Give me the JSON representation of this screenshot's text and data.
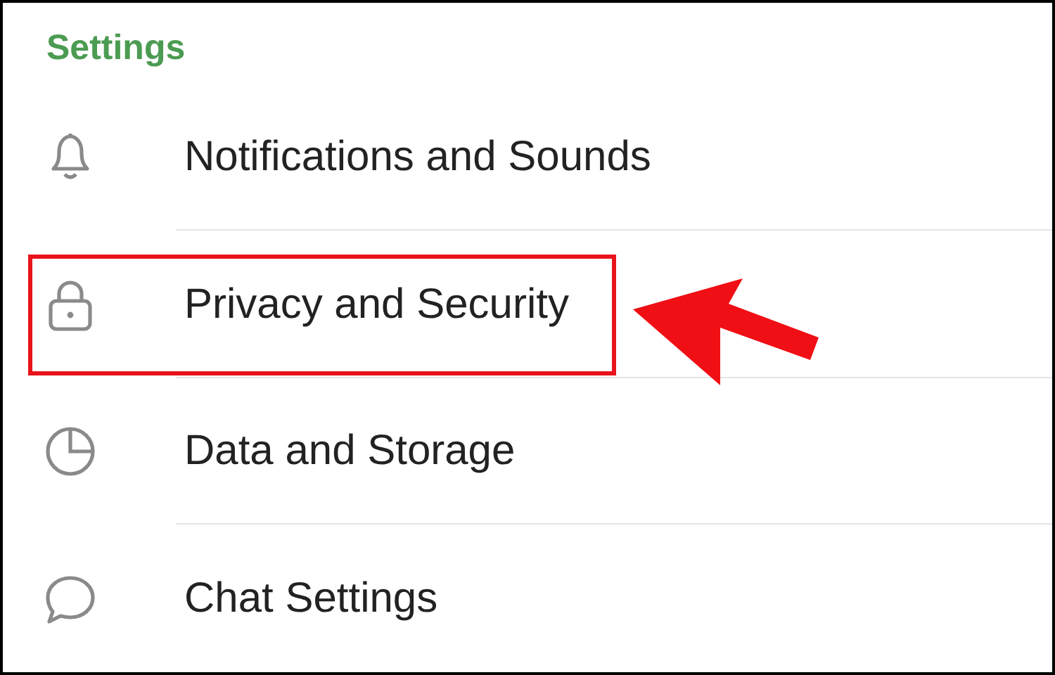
{
  "header": {
    "title": "Settings"
  },
  "items": [
    {
      "label": "Notifications and Sounds",
      "highlighted": false
    },
    {
      "label": "Privacy and Security",
      "highlighted": true
    },
    {
      "label": "Data and Storage",
      "highlighted": false
    },
    {
      "label": "Chat Settings",
      "highlighted": false
    }
  ]
}
